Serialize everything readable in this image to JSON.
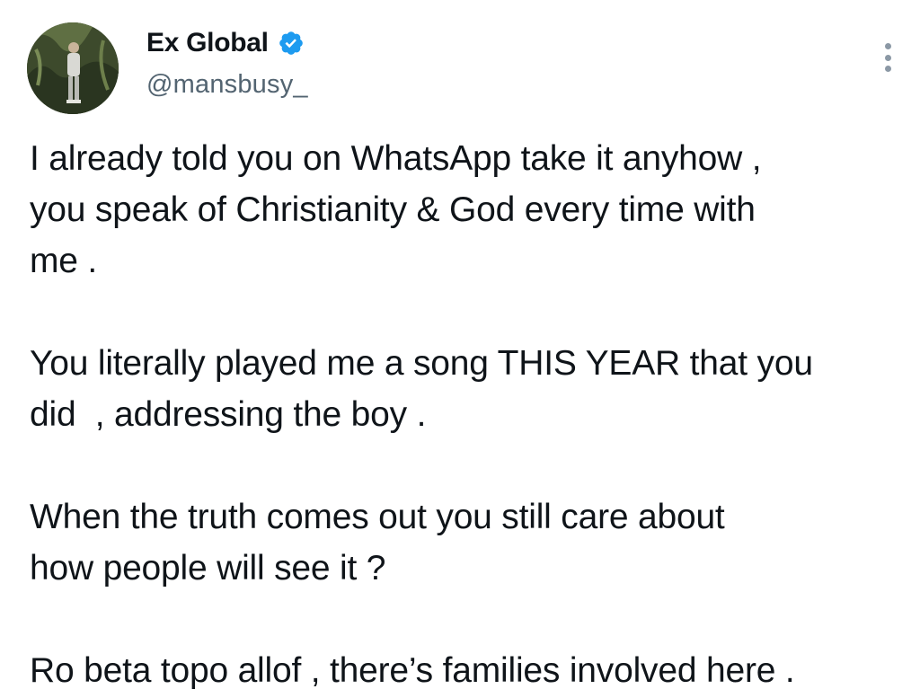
{
  "tweet": {
    "author": {
      "display_name": "Ex Global",
      "handle": "@mansbusy_",
      "verified": true,
      "verified_badge_icon": "verified-badge-icon",
      "avatar_icon": "avatar-photo"
    },
    "more_menu_icon": "more-vertical-icon",
    "paragraphs": [
      "I already told you on WhatsApp take it anyhow ,\nyou speak of Christianity & God every time with\nme .",
      "You literally played me a song THIS YEAR that you\ndid  , addressing the boy .",
      "When the truth comes out you still care about\nhow people will see it ?",
      "Ro beta topo allof , there’s families involved here ."
    ]
  },
  "colors": {
    "text": "#0f1419",
    "secondary_text": "#536471",
    "verified_blue": "#1d9bf0",
    "background": "#ffffff"
  }
}
